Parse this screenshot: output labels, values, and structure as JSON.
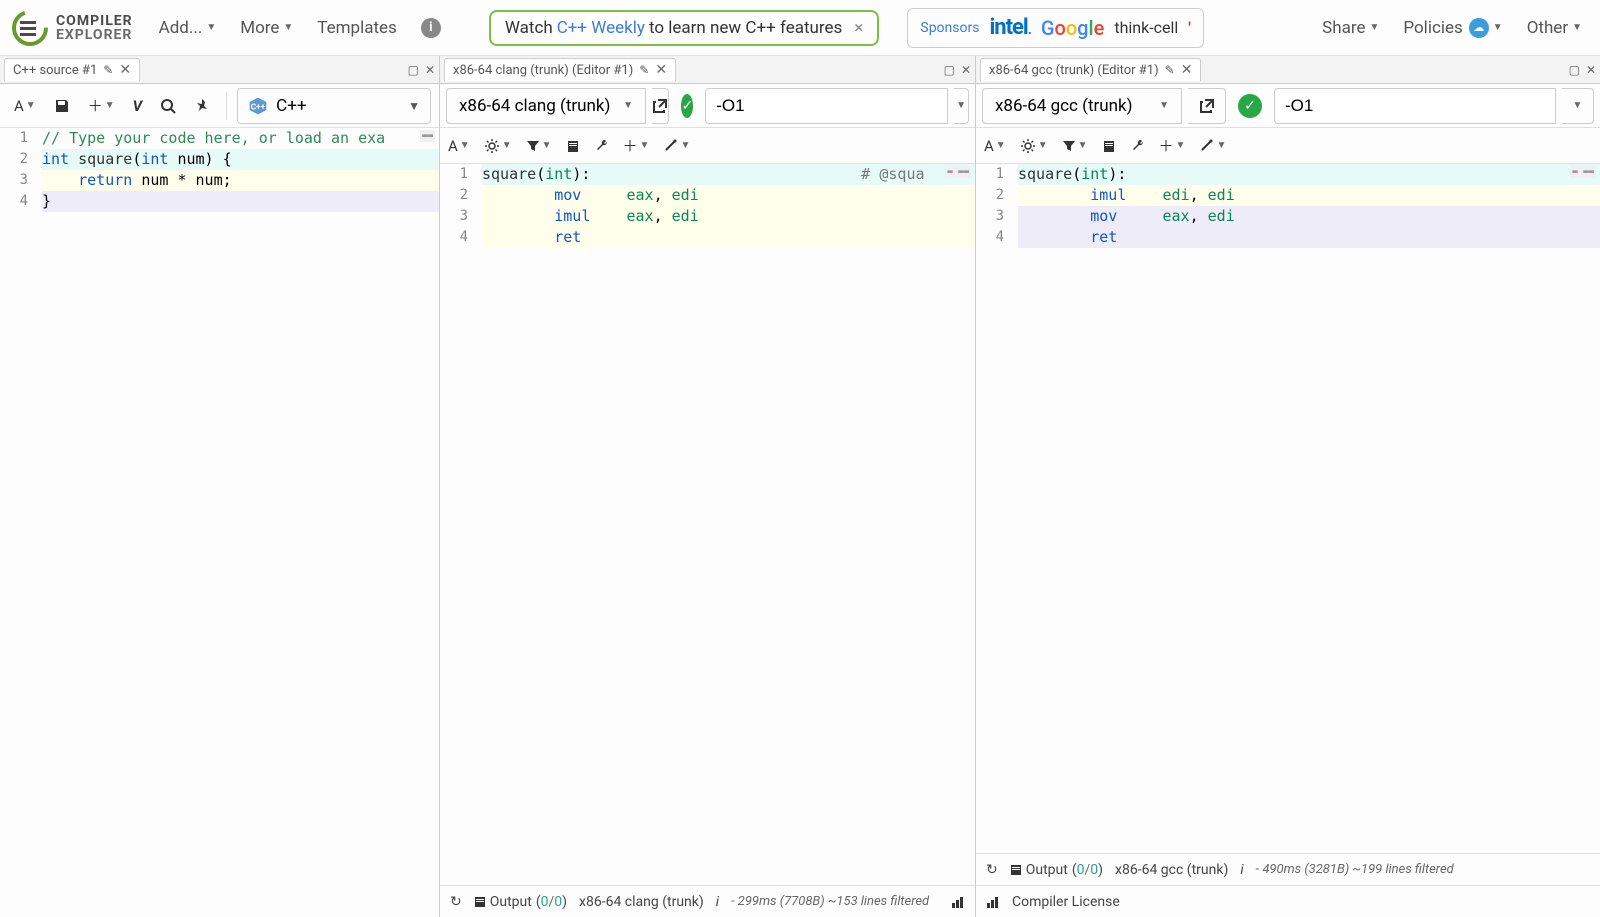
{
  "logo": {
    "line1": "COMPILER",
    "line2": "EXPLORER"
  },
  "nav": {
    "add": "Add...",
    "more": "More",
    "templates": "Templates"
  },
  "banner": {
    "prefix": "Watch ",
    "link": "C++ Weekly",
    "suffix": " to learn new C++ features"
  },
  "sponsors": {
    "label": "Sponsors",
    "intel": "intel",
    "thinkcell": "think-cell"
  },
  "rightnav": {
    "share": "Share",
    "policies": "Policies",
    "other": "Other"
  },
  "source": {
    "tab": "C++ source #1",
    "lang": "C++",
    "lines": [
      {
        "n": 1,
        "cls": "",
        "html": "<span class='c-comment'>// Type your code here, or load an exa</span>"
      },
      {
        "n": 2,
        "cls": "hl-green",
        "html": "<span class='c-keyword'>int</span> <span class='c-func'>square</span>(<span class='c-keyword'>int</span> num) {"
      },
      {
        "n": 3,
        "cls": "hl-yellow",
        "html": "    <span class='c-keyword'>return</span> num * num;"
      },
      {
        "n": 4,
        "cls": "hl-purple",
        "html": "}"
      }
    ]
  },
  "compiler1": {
    "tab": "x86-64 clang (trunk) (Editor #1)",
    "name": "x86-64 clang (trunk)",
    "opts": "-O1",
    "lines": [
      {
        "n": 1,
        "cls": "hl-green",
        "html": "<span class='c-func'>square</span>(<span class='c-type'>int</span>):                              <span class='c-asm-comment'># @squa</span>"
      },
      {
        "n": 2,
        "cls": "hl-yellow",
        "html": "        <span class='c-asm-op'>mov</span>     <span class='c-asm-reg'>eax</span>, <span class='c-asm-reg'>edi</span>"
      },
      {
        "n": 3,
        "cls": "hl-yellow",
        "html": "        <span class='c-asm-op'>imul</span>    <span class='c-asm-reg'>eax</span>, <span class='c-asm-reg'>edi</span>"
      },
      {
        "n": 4,
        "cls": "hl-yellow",
        "html": "        <span class='c-asm-op'>ret</span>"
      }
    ],
    "status": {
      "output": "Output",
      "o1": "0",
      "o2": "0",
      "compiler": "x86-64 clang (trunk)",
      "timing": "- 299ms (7708B) ~153 lines filtered"
    }
  },
  "compiler2": {
    "tab": "x86-64 gcc (trunk) (Editor #1)",
    "name": "x86-64 gcc (trunk)",
    "opts": "-O1",
    "lines": [
      {
        "n": 1,
        "cls": "hl-green",
        "html": "<span class='c-func'>square</span>(<span class='c-type'>int</span>):"
      },
      {
        "n": 2,
        "cls": "hl-yellow",
        "html": "        <span class='c-asm-op'>imul</span>    <span class='c-asm-reg'>edi</span>, <span class='c-asm-reg'>edi</span>"
      },
      {
        "n": 3,
        "cls": "hl-purple",
        "html": "        <span class='c-asm-op'>mov</span>     <span class='c-asm-reg'>eax</span>, <span class='c-asm-reg'>edi</span>"
      },
      {
        "n": 4,
        "cls": "hl-purple",
        "html": "        <span class='c-asm-op'>ret</span>"
      }
    ],
    "status": {
      "output": "Output",
      "o1": "0",
      "o2": "0",
      "compiler": "x86-64 gcc (trunk)",
      "timing": "- 490ms (3281B) ~199 lines filtered"
    },
    "license": "Compiler License"
  }
}
